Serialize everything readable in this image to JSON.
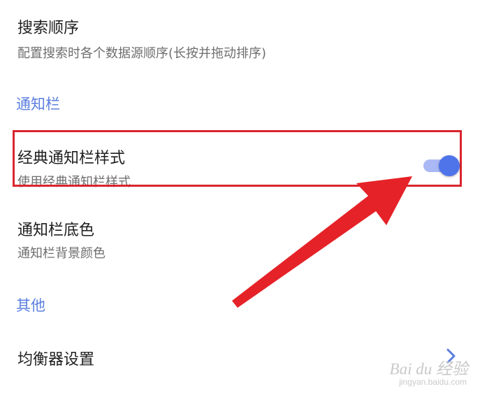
{
  "colors": {
    "accent": "#5b7fe0",
    "highlight": "#d9252e",
    "switch_thumb": "#4f74ea",
    "switch_track": "#aab9f5"
  },
  "settings": {
    "search_order": {
      "title": "搜索顺序",
      "summary": "配置搜索时各个数据源顺序(长按并拖动排序)"
    },
    "notification_category": "通知栏",
    "classic_style": {
      "title": "经典通知栏样式",
      "summary": "使用经典通知栏样式",
      "switch_on": true
    },
    "bar_color": {
      "title": "通知栏底色",
      "summary": "通知栏背景颜色"
    },
    "other_category": "其他",
    "equalizer": {
      "title": "均衡器设置",
      "icon": "chevron-right-icon"
    }
  },
  "watermark": {
    "logo": "Bai du 经验",
    "url": "jingyan.baidu.com"
  }
}
